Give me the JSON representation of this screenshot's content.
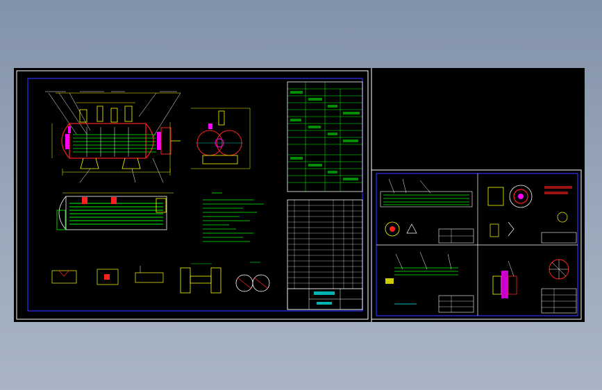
{
  "viewer": {
    "background": "#8b9bb0",
    "canvas_color": "#000000"
  },
  "colors": {
    "frame": "#ffffff",
    "border": "#2f2fff",
    "green": "#00ff00",
    "yellow": "#ffff00",
    "red": "#ff2020",
    "magenta": "#ff00ff",
    "cyan": "#00ffff",
    "white": "#ffffff"
  },
  "sheets": [
    {
      "id": "main-assembly-sheet",
      "title": ""
    },
    {
      "id": "detail-sheet",
      "title": ""
    }
  ],
  "detail_views": [
    {
      "id": "tube-bundle-view"
    },
    {
      "id": "tubesheet-view"
    },
    {
      "id": "baffle-view"
    },
    {
      "id": "flange-view"
    }
  ]
}
